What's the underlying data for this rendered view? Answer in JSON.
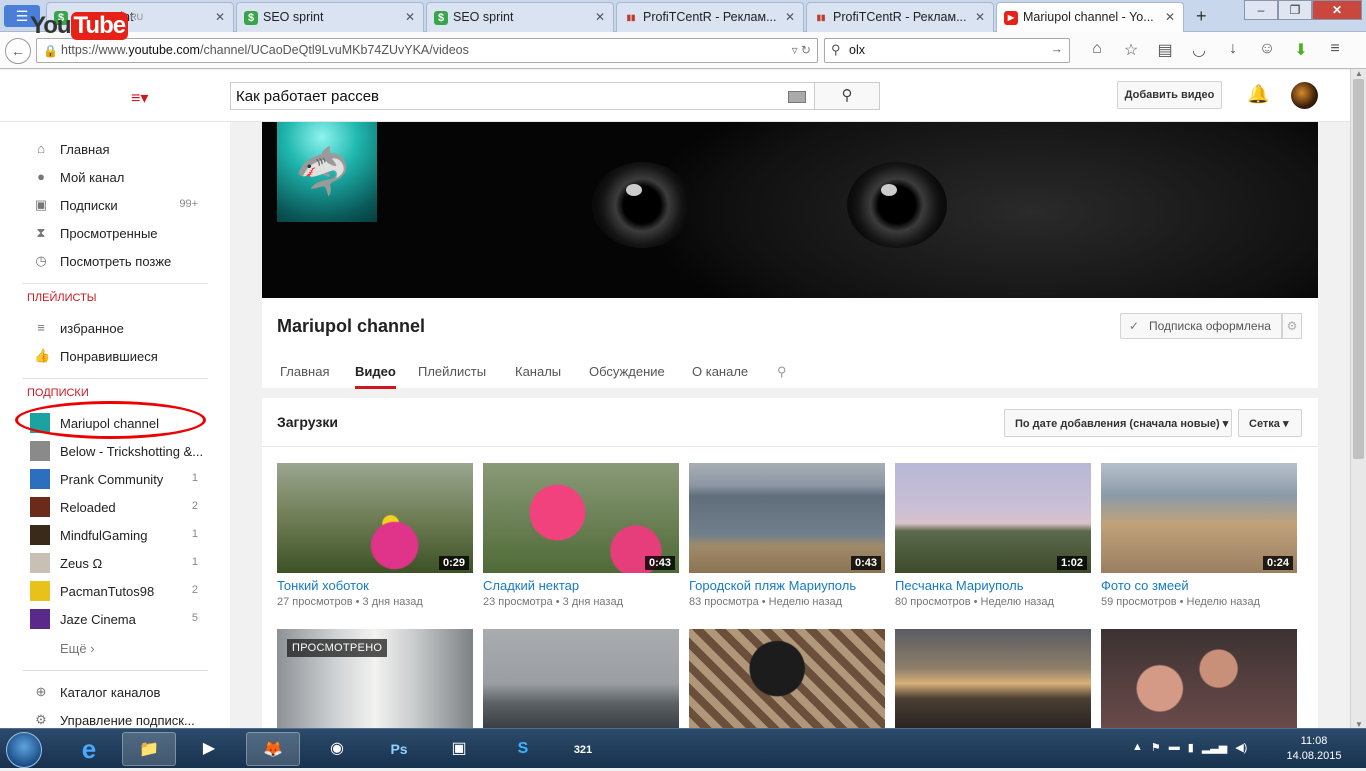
{
  "browser": {
    "tabs": [
      {
        "title": "SEO sprint",
        "icon": "seo-sprint-icon",
        "active": false
      },
      {
        "title": "SEO sprint",
        "icon": "seo-sprint-icon",
        "active": false
      },
      {
        "title": "SEO sprint",
        "icon": "seo-sprint-icon",
        "active": false
      },
      {
        "title": "ProfiTCentR - Реклам...",
        "icon": "bar-chart-icon",
        "active": false
      },
      {
        "title": "ProfiTCentR - Реклам...",
        "icon": "bar-chart-icon",
        "active": false
      },
      {
        "title": "Mariupol channel - Yo...",
        "icon": "youtube-icon",
        "active": true
      }
    ],
    "url_prefix": "https://www.",
    "url_domain": "youtube.com",
    "url_path": "/channel/UCaoDeQtl9LvuMKb74ZUvYKA/videos",
    "search_value": "olx"
  },
  "youtube": {
    "logo_you": "You",
    "logo_tube": "Tube",
    "logo_region": "RU",
    "search_value": "Как работает рассев",
    "upload_label": "Добавить видео"
  },
  "sidebar": {
    "main": [
      {
        "label": "Главная",
        "icon": "home-icon"
      },
      {
        "label": "Мой канал",
        "icon": "user-icon"
      },
      {
        "label": "Подписки",
        "icon": "subscriptions-icon",
        "count": "99+"
      },
      {
        "label": "Просмотренные",
        "icon": "hourglass-icon"
      },
      {
        "label": "Посмотреть позже",
        "icon": "clock-icon"
      }
    ],
    "playlists_heading": "ПЛЕЙЛИСТЫ",
    "playlists": [
      {
        "label": "избранное",
        "icon": "list-icon"
      },
      {
        "label": "Понравившиеся",
        "icon": "thumbs-up-icon"
      }
    ],
    "subscriptions_heading": "ПОДПИСКИ",
    "subscriptions": [
      {
        "label": "Mariupol channel",
        "count": "",
        "color": "#1aa3a0"
      },
      {
        "label": "Below - Trickshotting &...",
        "count": "",
        "color": "#8a8a8a"
      },
      {
        "label": "Prank Community",
        "count": "1",
        "color": "#2d6fbf"
      },
      {
        "label": "Reloaded",
        "count": "2",
        "color": "#6b2a1a"
      },
      {
        "label": "MindfulGaming",
        "count": "1",
        "color": "#3a2a1a"
      },
      {
        "label": "Zeus Ω",
        "count": "1",
        "color": "#c9c0b5"
      },
      {
        "label": "PacmanTutos98",
        "count": "2",
        "color": "#e8c21a"
      },
      {
        "label": "Jaze Cinema",
        "count": "5",
        "color": "#5a2a8a"
      }
    ],
    "more_label": "Ещё ›",
    "bottom": [
      {
        "label": "Каталог каналов",
        "icon": "plus-circle-icon"
      },
      {
        "label": "Управление подписк...",
        "icon": "gear-icon"
      }
    ]
  },
  "channel": {
    "title": "Mariupol channel",
    "subscribe_label": "Подписка оформлена",
    "tabs": [
      "Главная",
      "Видео",
      "Плейлисты",
      "Каналы",
      "Обсуждение",
      "О канале"
    ],
    "active_tab": "Видео",
    "uploads_title": "Загрузки",
    "sort_label": "По дате добавления (сначала новые)",
    "view_label": "Сетка",
    "watched_label": "ПРОСМОТРЕНО"
  },
  "videos": [
    {
      "title": "Тонкий хоботок",
      "views": "27 просмотров",
      "age": "3 дня назад",
      "duration": "0:29",
      "theme": "flower"
    },
    {
      "title": "Сладкий нектар",
      "views": "23 просмотра",
      "age": "3 дня назад",
      "duration": "0:43",
      "theme": "flower2"
    },
    {
      "title": "Городской пляж Мариуполь",
      "views": "83 просмотра",
      "age": "Неделю назад",
      "duration": "0:43",
      "theme": "sea"
    },
    {
      "title": "Песчанка Мариуполь",
      "views": "80 просмотров",
      "age": "Неделю назад",
      "duration": "1:02",
      "theme": "sky"
    },
    {
      "title": "Фото со змеей",
      "views": "59 просмотров",
      "age": "Неделю назад",
      "duration": "0:24",
      "theme": "beach"
    }
  ],
  "videos_row2_themes": [
    "corridor",
    "port",
    "cat",
    "sunset",
    "party"
  ],
  "taskbar": {
    "time": "11:08",
    "date": "14.08.2015"
  }
}
